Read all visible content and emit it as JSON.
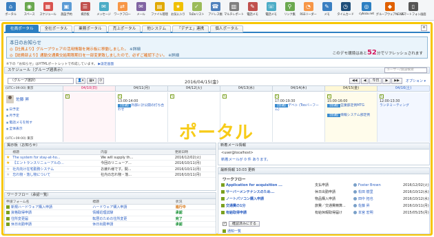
{
  "apps": [
    {
      "label": "ポータル",
      "icon": "portal-icon",
      "color": "#3a7fc1"
    },
    {
      "label": "スペース",
      "icon": "space-icon",
      "color": "#6aa84f"
    },
    {
      "label": "スケジュール",
      "icon": "schedule-icon",
      "color": "#d9534f"
    },
    {
      "label": "施設予約",
      "icon": "facility-icon",
      "color": "#5b9bd5"
    },
    {
      "label": "掲示板",
      "icon": "bulletin-icon",
      "color": "#c0504d"
    },
    {
      "label": "メッセージ",
      "icon": "message-icon",
      "color": "#4bacc6"
    },
    {
      "label": "ワークフロー",
      "icon": "workflow-icon",
      "color": "#f79646"
    },
    {
      "label": "メール",
      "icon": "mail-icon",
      "color": "#8064a2"
    },
    {
      "label": "ファイル管理",
      "icon": "file-icon",
      "color": "#e0a800"
    },
    {
      "label": "お気に入り",
      "icon": "favorite-icon",
      "color": "#f0c000"
    },
    {
      "label": "ToDoリスト",
      "icon": "todo-icon",
      "color": "#9bbb59"
    },
    {
      "label": "アドレス帳",
      "icon": "address-icon",
      "color": "#4f81bd"
    },
    {
      "label": "マルチレポート",
      "icon": "report-icon",
      "color": "#7f7f7f"
    },
    {
      "label": "電話メモ",
      "icon": "phone-memo-icon",
      "color": "#c0504d"
    },
    {
      "label": "電話メモ",
      "icon": "phone-icon",
      "color": "#4bacc6"
    },
    {
      "label": "リンク集",
      "icon": "link-icon",
      "color": "#6aa84f"
    },
    {
      "label": "RSSリーダー",
      "icon": "rss-icon",
      "color": "#f79646"
    },
    {
      "label": "メモ",
      "icon": "memo-icon",
      "color": "#3a7fc1"
    },
    {
      "label": "タイムカード",
      "icon": "timecard-icon",
      "color": "#1f4e79"
    },
    {
      "label": "cybozu.net",
      "icon": "cybozu-icon",
      "color": "#2c7fc2"
    },
    {
      "label": "グループウェアNEWS",
      "icon": "news-icon",
      "color": "#e06000"
    },
    {
      "label": "スマートフォン画面",
      "icon": "smartphone-icon",
      "color": "#555555"
    }
  ],
  "tabs": [
    "社員ポータル",
    "全社ポータル",
    "業務ポータル",
    "売上ポータル",
    "他システム",
    "「デヂエ」連携",
    "個人ポータル"
  ],
  "notice": {
    "title": "本日のお知らせ",
    "line1": "◎【社員より】グループウェアの活用情報を掲示板に移動しました。",
    "line1_detail": "※詳細",
    "line2": "◎【総務部より】通勤交通費交給期限期日を一部変更致しましたので、必ずご確認下さい。",
    "line2_detail": "※詳細",
    "refresh_prefix": "このデモ環境はあと",
    "refresh_num": "52",
    "refresh_suffix": "分でリフレッシュされます"
  },
  "html_hint": {
    "text": "※下の「お知らせ」はHTMLポートレットで作成しています。",
    "link": "▶設定画面"
  },
  "schedule": {
    "title": "スケジュール（グループ週表示）",
    "search_placeholder": "ユーザー/施設検索",
    "group_select": "（グループ選択）",
    "date": "2016/04/15(金)",
    "nav": [
      "◀◀",
      "◀",
      "今日",
      "▶",
      "▶▶"
    ],
    "options": "オプション ▾",
    "tz": "(UTC+09:00) 東京",
    "days": [
      "04/10(日)",
      "04/11(月)",
      "04/12(火)",
      "04/13(水)",
      "04/14(木)",
      "04/15(金)",
      "04/16(土)"
    ],
    "user": "佐藤 昇",
    "user_links": [
      "日予定",
      "月予定",
      "電話メモを残す",
      "全体表示"
    ],
    "tz_bottom": "(UTC+09:00) 東京"
  },
  "events": [
    {
      "day": 1,
      "time": "13:00-14:00",
      "tag": "【会議】",
      "text": "外部に計公開の打ち合わせ"
    },
    {
      "day": 4,
      "time": "17:00-19:30",
      "tag": "【会議】",
      "text": "デベト (Tooバーフーム)"
    },
    {
      "day": 5,
      "time": "15:00-16:00",
      "tag": "【会議】",
      "text": "営業部定例MTG"
    },
    {
      "day": 5,
      "time": "",
      "tag": "【会議】",
      "text": "情報システム部定例"
    },
    {
      "day": 6,
      "time": "12:00-13:30",
      "tag": "",
      "text": "ランチミーティング"
    }
  ],
  "bulletin": {
    "title": "掲示板（お知らせ）",
    "headers": [
      "標題",
      "内容",
      "更新日時"
    ],
    "rows": [
      {
        "star": true,
        "title": "The system for stay-at-ho...",
        "body": "We will supply th...",
        "date": "2016/12/02(火)"
      },
      {
        "star": true,
        "title": "【エントランスリニューアルの...",
        "body": "今回のリニューア...",
        "date": "2016/10/11(月)"
      },
      {
        "star": false,
        "title": "社内向け在宅勤務システム",
        "body": "お疲れ様です。関...",
        "date": "2016/10/11(月)"
      },
      {
        "star": false,
        "title": "忘れ物・落し物について",
        "body": "社内の忘れ物・落...",
        "date": "2016/10/11(月)"
      }
    ]
  },
  "workflow_list": {
    "title": "ワークフロー（承認一覧）",
    "headers": [
      "申請フォーム名",
      "標題",
      "状況"
    ],
    "rows": [
      {
        "form": "新規ハードウェア購入申請",
        "subject": "ハードウェア購入申請",
        "status": "進行中",
        "kind": "wait"
      },
      {
        "form": "資格取得申請",
        "subject": "情報処理試験",
        "status": "承認",
        "kind": "ok"
      },
      {
        "form": "住所変更届",
        "subject": "転居のための住所変更",
        "status": "完了",
        "kind": "done"
      },
      {
        "form": "休日出勤申請",
        "subject": "休日出勤申請",
        "status": "承認",
        "kind": "ok"
      }
    ]
  },
  "mail": {
    "title": "新着メール情報",
    "account": "<user@localhost>",
    "new_count": "新着メールが 0 件 あります。"
  },
  "updates": {
    "title": "最新情報 10:03 更新",
    "workflow_label": "ワークフロー",
    "rows": [
      {
        "title": "Application for acquisition ...",
        "kind": "支払申請",
        "user": "Foster Brown",
        "date": "2016/12/02(火)"
      },
      {
        "title": "サーバーメンテナンスのため...",
        "kind": "休日出勤申請",
        "user": "松田 樹里",
        "date": "2016/10/12(水)"
      },
      {
        "title": "ノートパソコン購入申請",
        "kind": "物品購入申請",
        "user": "田中 拓也",
        "date": "2016/10/12(水)"
      },
      {
        "title": "交通費の1分",
        "kind": "旅費／交通費精算...",
        "user": "佐藤 昇",
        "date": "2016/10/11(月)"
      },
      {
        "title": "有給取得申請",
        "kind": "有給休暇取得届け",
        "user": "本宮 宏明",
        "date": "2015/05/25(月)"
      }
    ],
    "confirm_button": "確認済みにする",
    "notice_label": "通知一覧"
  },
  "watermark": "ポータル"
}
